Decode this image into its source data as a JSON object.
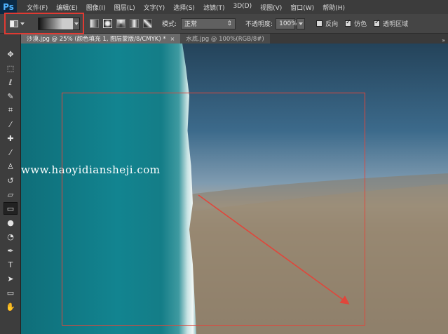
{
  "app": {
    "logo": "Ps"
  },
  "menu": [
    "文件(F)",
    "编辑(E)",
    "图像(I)",
    "图层(L)",
    "文字(Y)",
    "选择(S)",
    "滤镜(T)",
    "3D(D)",
    "视图(V)",
    "窗口(W)",
    "帮助(H)"
  ],
  "options": {
    "mode_label": "模式:",
    "mode_value": "正常",
    "opacity_label": "不透明度:",
    "opacity_value": "100%",
    "reverse_label": "反向",
    "reverse_checked": false,
    "dither_label": "仿色",
    "dither_checked": true,
    "transparency_label": "透明区域",
    "transparency_checked": true
  },
  "tabs": [
    {
      "title": "沙漠.jpg @ 25% (颜色填充 1, 图层蒙版/8/CMYK) *",
      "active": true
    },
    {
      "title": "水底.jpg @ 100%(RGB/8#)",
      "active": false
    }
  ],
  "canvas": {
    "watermark": "www.haoyidiansheji.com",
    "annotation_color": "#e0463b"
  },
  "tools": [
    "move-icon",
    "marquee-icon",
    "lasso-icon",
    "quick-select-icon",
    "crop-icon",
    "eyedropper-icon",
    "healing-brush-icon",
    "brush-icon",
    "clone-stamp-icon",
    "history-brush-icon",
    "eraser-icon",
    "gradient-icon",
    "blur-icon",
    "dodge-icon",
    "pen-icon",
    "type-icon",
    "path-select-icon",
    "rectangle-icon",
    "hand-icon"
  ]
}
